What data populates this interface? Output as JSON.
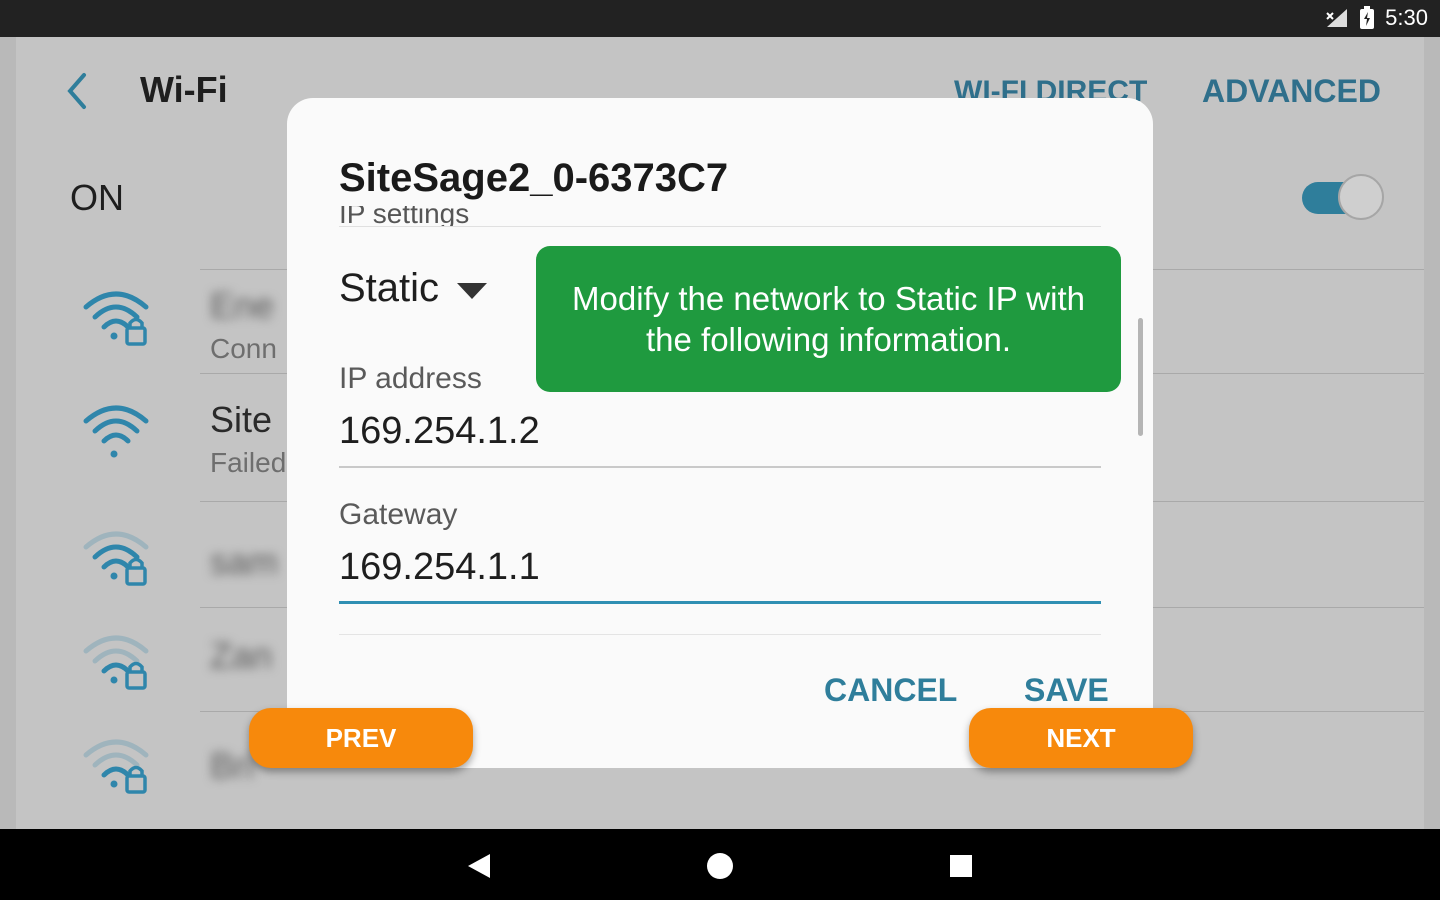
{
  "status_bar": {
    "time": "5:30",
    "icons": [
      "signal-icon",
      "battery-icon"
    ]
  },
  "header": {
    "title": "Wi-Fi",
    "actions": [
      {
        "label": "WI-FI DIRECT"
      },
      {
        "label": "ADVANCED"
      }
    ]
  },
  "wifi_toggle": {
    "label": "ON",
    "state": "on"
  },
  "networks": [
    {
      "ssid": "Ene",
      "status": "Conn",
      "icon": "wifi-lock-icon"
    },
    {
      "ssid": "Site",
      "status": "Failed",
      "icon": "wifi-icon"
    },
    {
      "ssid": "sam",
      "status": "",
      "icon": "wifi-lock-icon"
    },
    {
      "ssid": "Zan",
      "status": "",
      "icon": "wifi-lock-icon"
    },
    {
      "ssid": "Bri",
      "status": "",
      "icon": "wifi-lock-icon"
    }
  ],
  "dialog": {
    "title": "SiteSage2_0-6373C7",
    "section_label": "IP settings",
    "ip_settings_value": "Static",
    "fields": [
      {
        "label": "IP address",
        "value": "169.254.1.2"
      },
      {
        "label": "Gateway",
        "value": "169.254.1.1"
      }
    ],
    "cancel_label": "CANCEL",
    "save_label": "SAVE"
  },
  "hint": {
    "text": "Modify the network to Static IP with the following information."
  },
  "tutorial": {
    "prev_label": "PREV",
    "next_label": "NEXT"
  },
  "colors": {
    "accent": "#2f7e9b",
    "hint_bg": "#1f9a3f",
    "tutorial_btn": "#f7890c"
  }
}
